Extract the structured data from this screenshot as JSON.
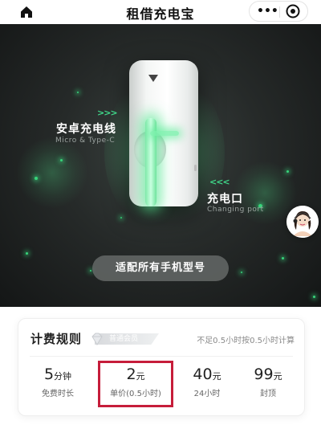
{
  "header": {
    "title": "租借充电宝",
    "more_icon": "more-dots-icon",
    "target_icon": "target-icon"
  },
  "hero": {
    "left_label": {
      "cn": "安卓充电线",
      "en": "Micro & Type-C",
      "arrows": ">>>"
    },
    "right_label": {
      "cn": "充电口",
      "en": "Changing port",
      "arrows": "<<<"
    },
    "pill": "适配所有手机型号",
    "accent": "#3fd98a"
  },
  "pricing": {
    "title": "计费规则",
    "badge": "普通会员",
    "note": "不足0.5小时按0.5小时计算",
    "highlight_color": "#c61d3a",
    "items": [
      {
        "value": "5",
        "unit": "分钟",
        "label": "免费时长"
      },
      {
        "value": "2",
        "unit": "元",
        "label": "单价(0.5小时)"
      },
      {
        "value": "40",
        "unit": "元",
        "label": "24小时"
      },
      {
        "value": "99",
        "unit": "元",
        "label": "封顶"
      }
    ]
  }
}
